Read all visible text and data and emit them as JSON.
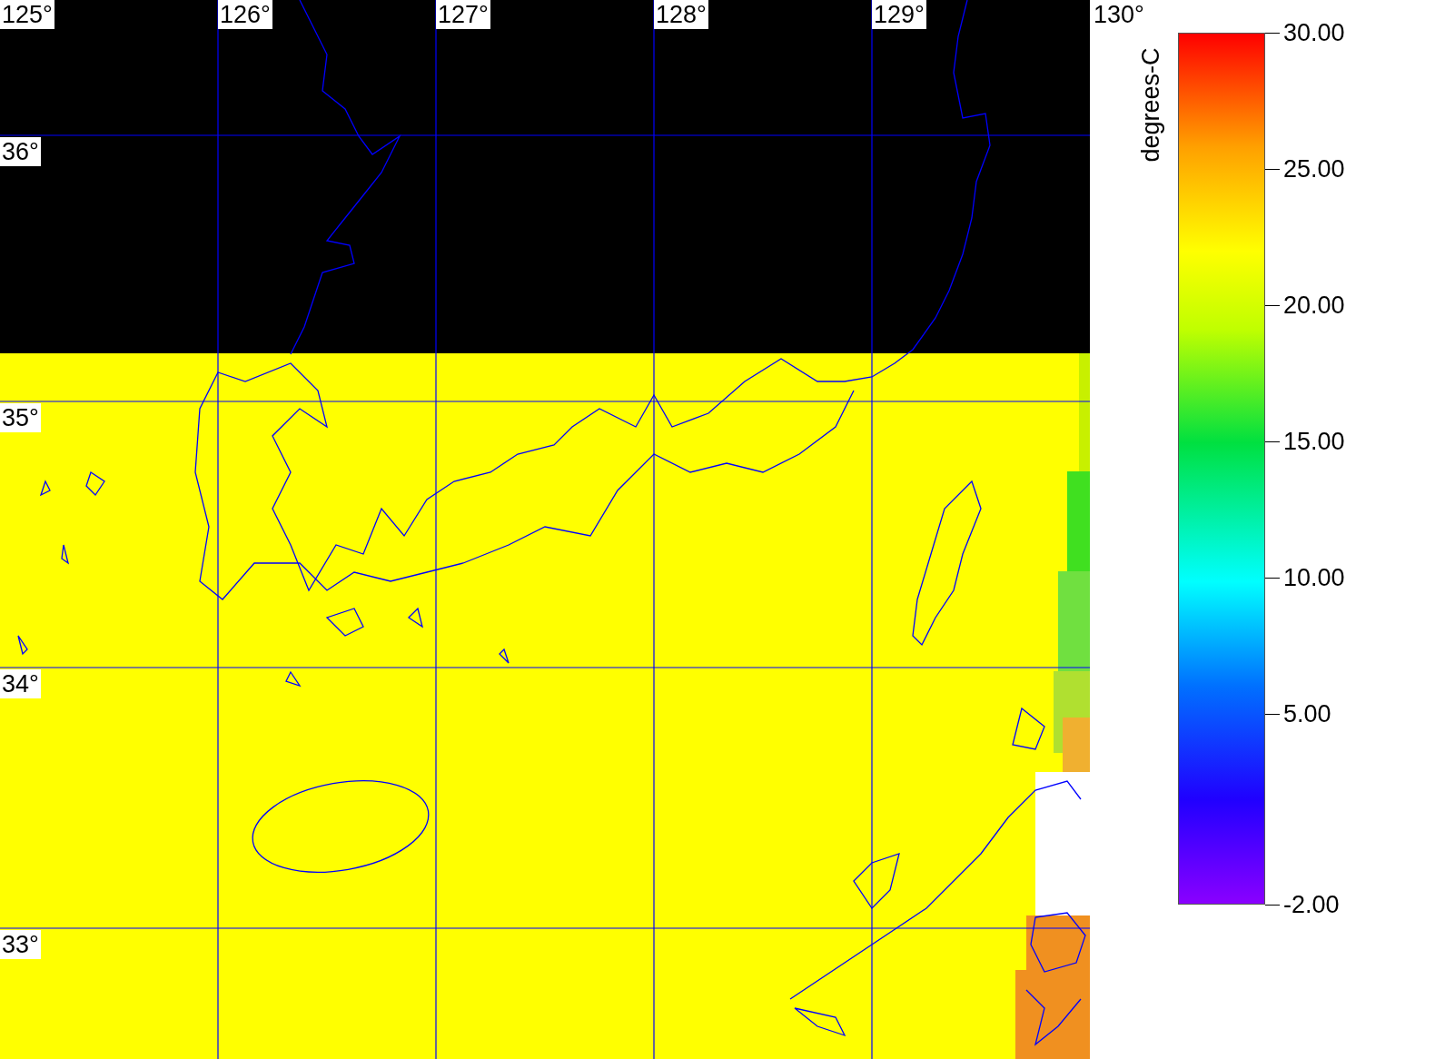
{
  "map": {
    "longitude_labels": [
      "125°",
      "126°",
      "127°",
      "128°",
      "129°",
      "130°"
    ],
    "latitude_labels": [
      "36°",
      "35°",
      "34°",
      "33°"
    ]
  },
  "colorbar": {
    "label": "degrees-C",
    "ticks": [
      "30.00",
      "25.00",
      "20.00",
      "15.00",
      "10.00",
      "5.00",
      "-2.00"
    ]
  }
}
